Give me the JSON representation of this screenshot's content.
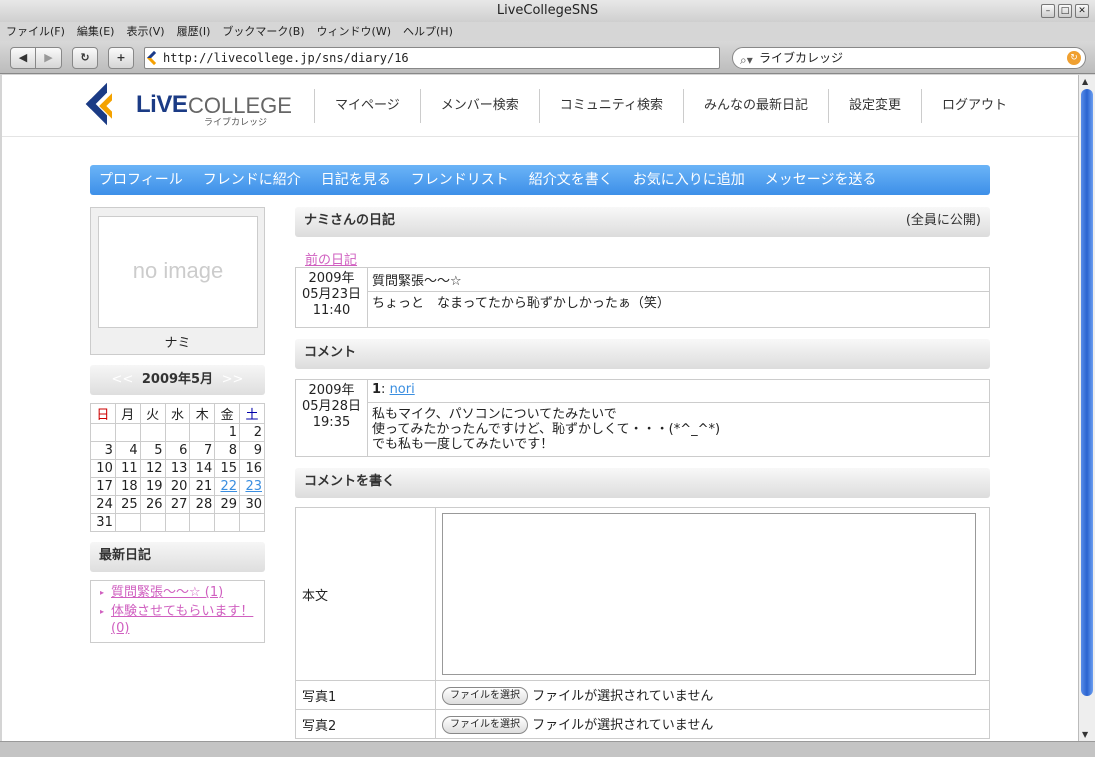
{
  "window": {
    "title": "LiveCollegeSNS",
    "min": "–",
    "max": "□",
    "close": "✕"
  },
  "menu": [
    "ファイル(F)",
    "編集(E)",
    "表示(V)",
    "履歴(I)",
    "ブックマーク(B)",
    "ウィンドウ(W)",
    "ヘルプ(H)"
  ],
  "toolbar": {
    "back": "◀",
    "forward": "▶",
    "reload": "↻",
    "add": "+",
    "url": "http://livecollege.jp/sns/diary/16",
    "search_value": "ライブカレッジ",
    "search_icon": "search-icon",
    "go": "↻"
  },
  "logo": {
    "brand_live": "LiVE",
    "brand_college": "COLLEGE",
    "kana": "ライブカレッジ"
  },
  "global_nav": [
    "マイページ",
    "メンバー検索",
    "コミュニティ検索",
    "みんなの最新日記",
    "設定変更",
    "ログアウト"
  ],
  "local_nav": [
    "プロフィール",
    "フレンドに紹介",
    "日記を見る",
    "フレンドリスト",
    "紹介文を書く",
    "お気に入りに追加",
    "メッセージを送る"
  ],
  "profile": {
    "photo_placeholder": "no image",
    "name": "ナミ"
  },
  "calendar": {
    "title": "2009年5月",
    "prev": "<<",
    "next": ">>",
    "dow": [
      "日",
      "月",
      "火",
      "水",
      "木",
      "金",
      "土"
    ],
    "weeks": [
      [
        "",
        "",
        "",
        "",
        "",
        "1",
        "2"
      ],
      [
        "3",
        "4",
        "5",
        "6",
        "7",
        "8",
        "9"
      ],
      [
        "10",
        "11",
        "12",
        "13",
        "14",
        "15",
        "16"
      ],
      [
        "17",
        "18",
        "19",
        "20",
        "21",
        "22",
        "23"
      ],
      [
        "24",
        "25",
        "26",
        "27",
        "28",
        "29",
        "30"
      ],
      [
        "31",
        "",
        "",
        "",
        "",
        "",
        ""
      ]
    ],
    "linked_days": [
      "22",
      "23"
    ]
  },
  "recent": {
    "title": "最新日記",
    "items": [
      "質問緊張～～☆ (1)",
      "体験させてもらいます！ (0)"
    ]
  },
  "diary": {
    "header": "ナミさんの日記",
    "visibility": "(全員に公開)",
    "prev_link": "前の日記",
    "date_year": "2009年",
    "date_md": "05月23日",
    "date_time": "11:40",
    "title": "質問緊張～～☆",
    "body": "ちょっと　なまってたから恥ずかしかったぁ（笑）"
  },
  "comments": {
    "header": "コメント",
    "items": [
      {
        "date_year": "2009年",
        "date_md": "05月28日",
        "date_time": "19:35",
        "number": "1",
        "author": "nori",
        "lines": [
          "私もマイク、パソコンについてたみたいで",
          "使ってみたかったんですけど、恥ずかしくて・・・(*^_^*)",
          "でも私も一度してみたいです！"
        ]
      }
    ]
  },
  "comment_form": {
    "header": "コメントを書く",
    "body_label": "本文",
    "photo1_label": "写真1",
    "photo2_label": "写真2",
    "file_button": "ファイルを選択",
    "file_none": "ファイルが選択されていません"
  }
}
